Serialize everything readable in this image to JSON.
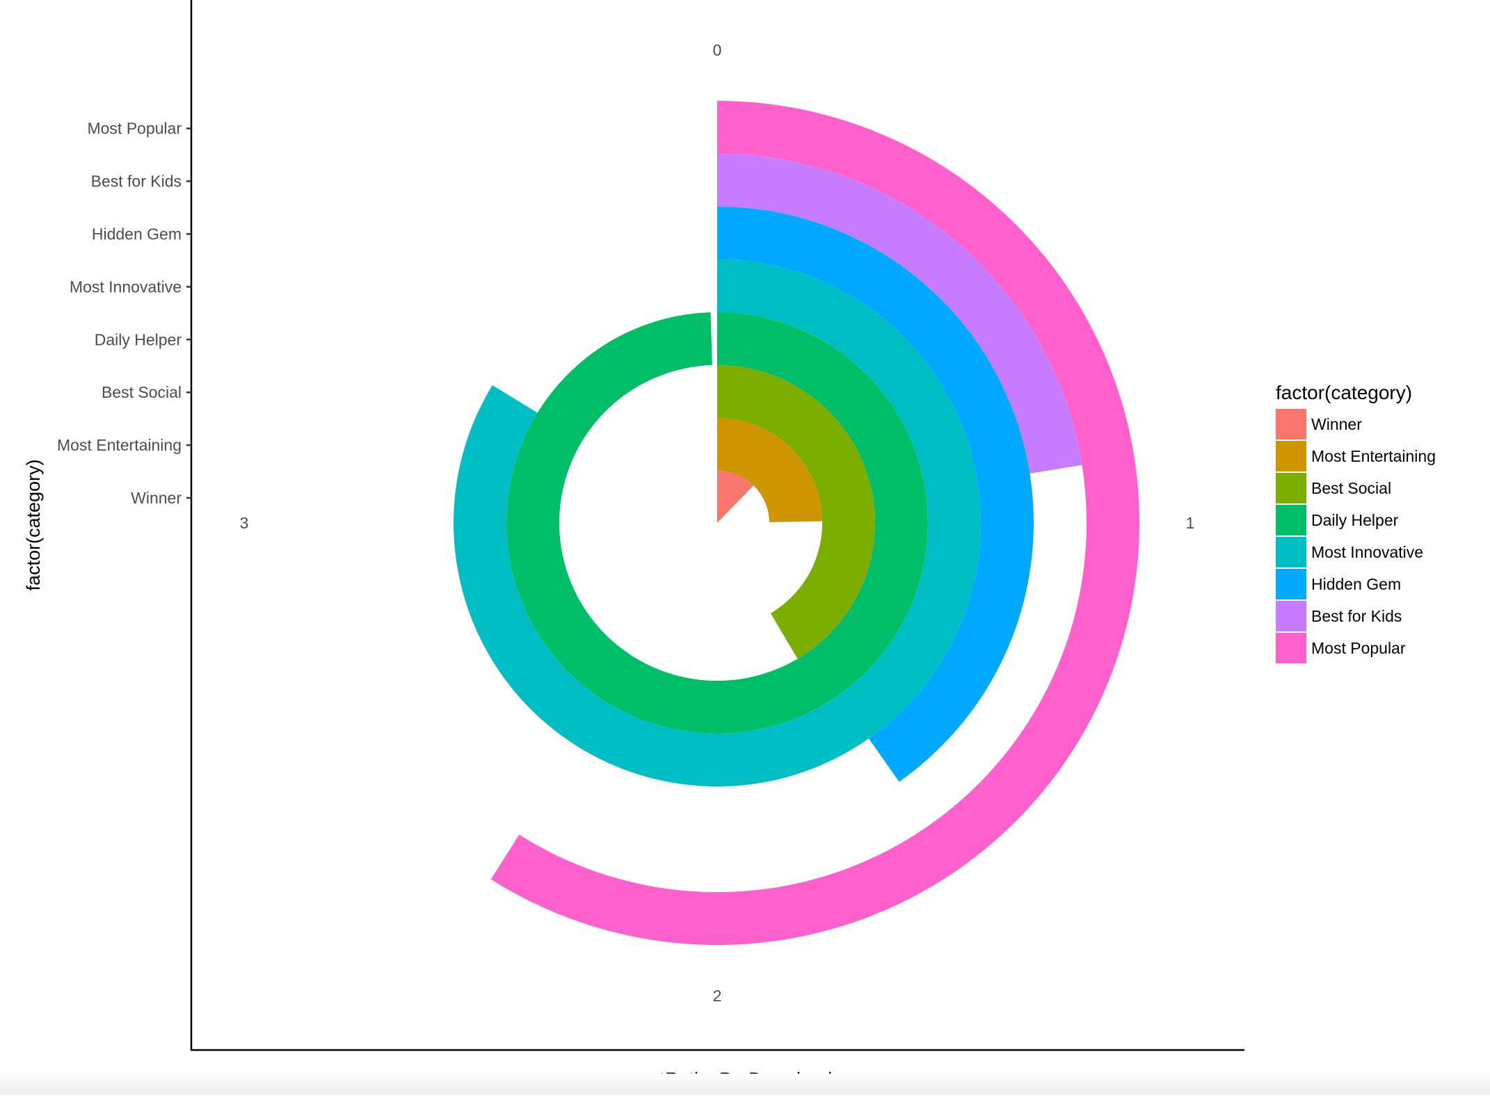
{
  "chart_data": {
    "type": "bar",
    "coord": "polar",
    "xlabel": "percentRatingPerDownload",
    "ylabel": "factor(category)",
    "categories": [
      "Winner",
      "Most Entertaining",
      "Best Social",
      "Daily Helper",
      "Most Innovative",
      "Hidden Gem",
      "Best for Kids",
      "Most Popular"
    ],
    "values": [
      0.49,
      0.99,
      1.66,
      3.98,
      3.35,
      1.61,
      0.9,
      2.36
    ],
    "colors": [
      "#F8766D",
      "#CD9600",
      "#7CAE00",
      "#00BE67",
      "#00BFC4",
      "#00A9FF",
      "#C77CFF",
      "#FF61CC"
    ],
    "theta_ticks": [
      "0",
      "1",
      "2",
      "3"
    ],
    "theta_range": [
      0,
      4
    ],
    "legend": {
      "title": "factor(category)",
      "position": "right",
      "items": [
        "Winner",
        "Most Entertaining",
        "Best Social",
        "Daily Helper",
        "Most Innovative",
        "Hidden Gem",
        "Best for Kids",
        "Most Popular"
      ]
    },
    "grid": false
  }
}
